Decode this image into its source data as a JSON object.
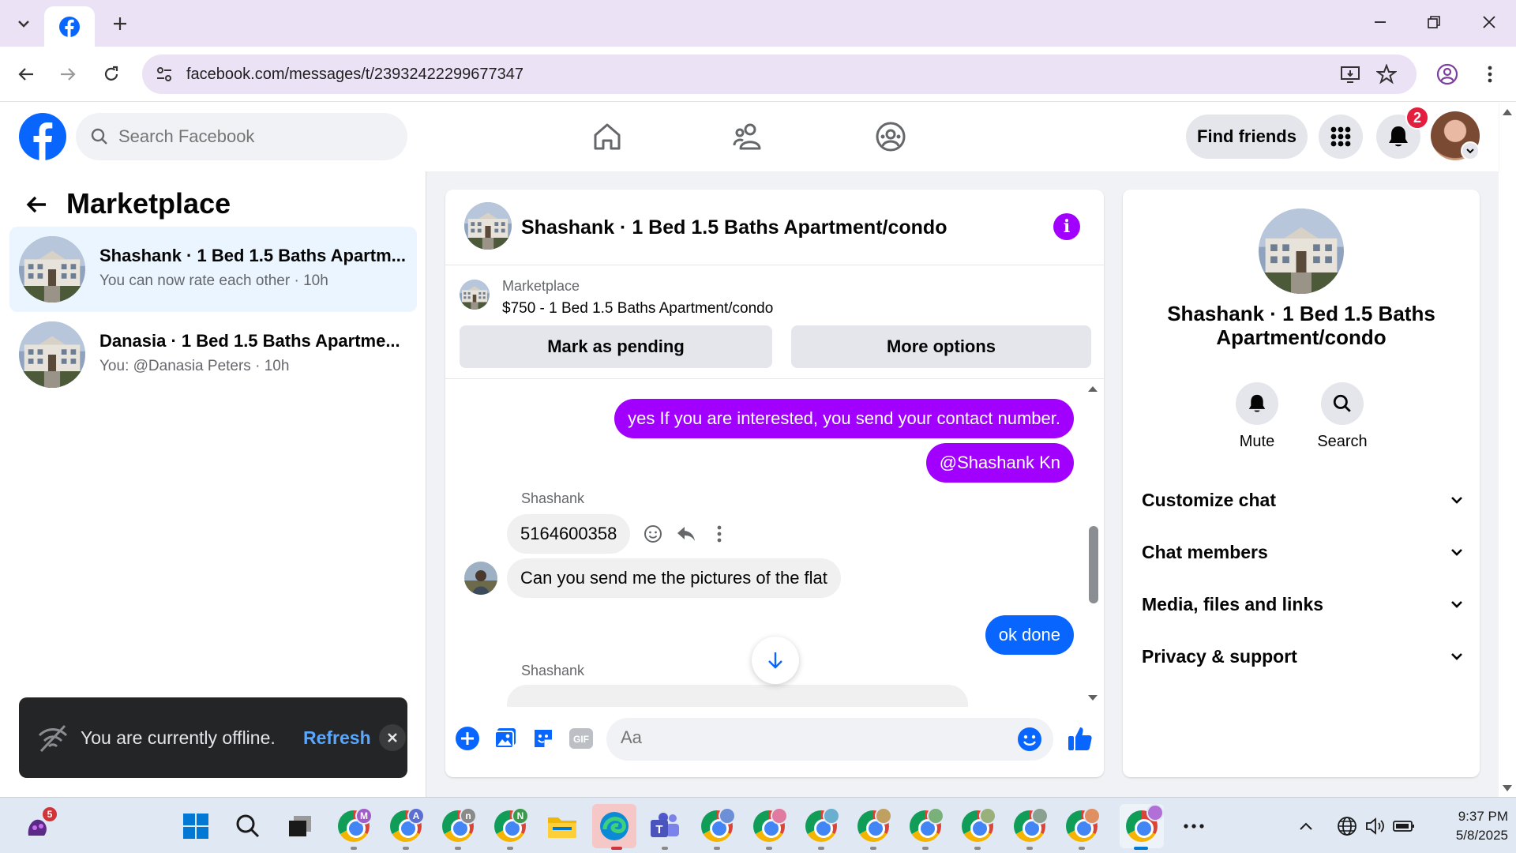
{
  "browser": {
    "url": "facebook.com/messages/t/23932422299677347"
  },
  "header": {
    "search_placeholder": "Search Facebook",
    "find_friends_label": "Find friends",
    "notification_count": "2"
  },
  "sidebar": {
    "title": "Marketplace",
    "conversations": [
      {
        "name": "Shashank · 1 Bed 1.5 Baths Apartm...",
        "preview": "You can now rate each other · 10h",
        "active": true
      },
      {
        "name": "Danasia · 1 Bed 1.5 Baths Apartme...",
        "preview": "You: @Danasia Peters · 10h",
        "active": false
      }
    ]
  },
  "toast": {
    "message": "You are currently offline.",
    "action": "Refresh"
  },
  "chat": {
    "title": "Shashank · 1 Bed 1.5 Baths Apartment/condo",
    "listing": {
      "label": "Marketplace",
      "price_title": "$750 - 1 Bed 1.5 Baths Apartment/condo",
      "mark_pending_label": "Mark as pending",
      "more_options_label": "More options"
    },
    "messages": [
      {
        "from": "me",
        "text": "yes If you are interested, you send your contact number."
      },
      {
        "from": "me",
        "text": "@Shashank Kn"
      },
      {
        "from": "them",
        "sender": "Shashank",
        "text": "5164600358"
      },
      {
        "from": "them",
        "text": "Can you send me the pictures of the flat"
      },
      {
        "from": "me",
        "text": "ok done"
      },
      {
        "from": "them",
        "sender": "Shashank",
        "text": ""
      }
    ],
    "composer_placeholder": "Aa"
  },
  "details": {
    "name": "Shashank · 1 Bed 1.5 Baths Apartment/condo",
    "actions": [
      {
        "label": "Mute",
        "icon": "bell-icon"
      },
      {
        "label": "Search",
        "icon": "search-icon"
      }
    ],
    "sections": [
      {
        "label": "Customize chat"
      },
      {
        "label": "Chat members"
      },
      {
        "label": "Media, files and links"
      },
      {
        "label": "Privacy & support"
      }
    ]
  },
  "taskbar": {
    "time": "9:37 PM",
    "date": "5/8/2025",
    "app_badge": "5",
    "chrome_profiles": [
      "M",
      "A",
      "n",
      "N"
    ]
  },
  "colors": {
    "fb_blue": "#0866ff",
    "messenger_purple": "#a100ff",
    "notification_red": "#e41e3f"
  }
}
